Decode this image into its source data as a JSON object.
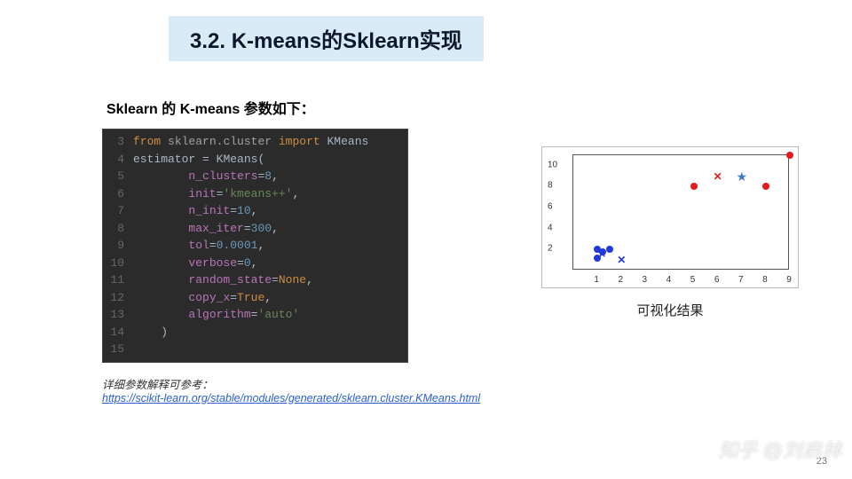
{
  "title": "3.2. K-means的Sklearn实现",
  "subtitle": "Sklearn 的 K-means 参数如下：",
  "code": {
    "lines": [
      {
        "n": "3",
        "html": "<span class='kw'>from</span> <span class='mod'>sklearn.cluster</span> <span class='kw'>import</span> <span class='cls'>KMeans</span>"
      },
      {
        "n": "4",
        "html": "<span class='cls'>estimator</span> <span class='eq'>=</span> <span class='cls'>KMeans(</span>"
      },
      {
        "n": "5",
        "html": "        <span class='param'>n_clusters</span><span class='eq'>=</span><span class='num'>8</span>,"
      },
      {
        "n": "6",
        "html": "        <span class='param'>init</span><span class='eq'>=</span><span class='str'>'kmeans++'</span>,"
      },
      {
        "n": "7",
        "html": "        <span class='param'>n_init</span><span class='eq'>=</span><span class='num'>10</span>,"
      },
      {
        "n": "8",
        "html": "        <span class='param'>max_iter</span><span class='eq'>=</span><span class='num'>300</span>,"
      },
      {
        "n": "9",
        "html": "        <span class='param'>tol</span><span class='eq'>=</span><span class='num'>0.0001</span>,"
      },
      {
        "n": "10",
        "html": "        <span class='param'>verbose</span><span class='eq'>=</span><span class='num'>0</span>,"
      },
      {
        "n": "11",
        "html": "        <span class='param'>random_state</span><span class='eq'>=</span><span class='none'>None</span>,"
      },
      {
        "n": "12",
        "html": "        <span class='param'>copy_x</span><span class='eq'>=</span><span class='none'>True</span>,"
      },
      {
        "n": "13",
        "html": "        <span class='param'>algorithm</span><span class='eq'>=</span><span class='str'>'auto'</span>"
      },
      {
        "n": "14",
        "html": "    <span class='cls'>)</span>"
      },
      {
        "n": "15",
        "html": ""
      }
    ]
  },
  "chart_data": {
    "type": "scatter",
    "title": "",
    "xlabel": "",
    "ylabel": "",
    "xlim": [
      0,
      9
    ],
    "ylim": [
      0,
      11
    ],
    "yticks": [
      2,
      4,
      6,
      8,
      10
    ],
    "xticks": [
      1,
      2,
      3,
      4,
      5,
      6,
      7,
      8,
      9
    ],
    "series": [
      {
        "name": "cluster1-point",
        "marker": "blue-dot",
        "points": [
          [
            1,
            2
          ],
          [
            1.5,
            2
          ],
          [
            1.2,
            1.8
          ],
          [
            1,
            1.2
          ]
        ]
      },
      {
        "name": "cluster1-centroid",
        "marker": "blue-star",
        "points": [
          [
            1.2,
            1.7
          ]
        ]
      },
      {
        "name": "cluster1-other",
        "marker": "blue-x",
        "points": [
          [
            2,
            1
          ]
        ]
      },
      {
        "name": "cluster2-point",
        "marker": "red-dot",
        "points": [
          [
            5,
            8
          ],
          [
            8,
            8
          ],
          [
            9,
            11
          ]
        ]
      },
      {
        "name": "cluster2-other",
        "marker": "red-x",
        "points": [
          [
            6,
            9
          ]
        ]
      },
      {
        "name": "cluster2-centroid",
        "marker": "lightblue-star",
        "points": [
          [
            7,
            9
          ]
        ]
      }
    ]
  },
  "plot_caption": "可视化结果",
  "footnote": {
    "label": "详细参数解释可参考：",
    "link_text": "https://scikit-learn.org/stable/modules/generated/sklearn.cluster.KMeans.html"
  },
  "pagenum": "23",
  "watermark": "知乎 @刘启林"
}
